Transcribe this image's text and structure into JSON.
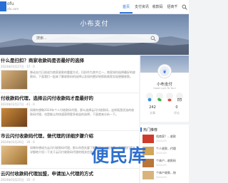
{
  "header": {
    "logo_text": "ofu",
    "logo_sub": "ofu.com",
    "nav": [
      "首页",
      "支付资讯",
      "收款码",
      "招商千"
    ],
    "active_index": 0
  },
  "banner": {
    "title": "小布支付",
    "search_placeholder": "搜索..."
  },
  "posts": [
    {
      "title": "什么是扫扣？商家收款码是否最好的选择",
      "meta": "2024年03月27日 · 37 · 0",
      "excerpt": "移动支付已经成为商家收款的重要方式，扫扣作为其中之一，商家如何选择最好的收款码，下面我们一起来了解收款码的选择以及如何更好地帮助商家实现便捷收款。"
    },
    {
      "title": "付收款码代理，选择云闪付收款码才是最好的",
      "meta": "2024年03月27日 · 41 · 0",
      "excerpt": "如果你想做2024年个人付收款码代理，那么选择云闪付收款码，这样既是优选的收款码代理，也是能让你快速获得更多收益的选择，下面就来分析一下。"
    },
    {
      "title": "市云闪付收款码代理，做代理的详细步骤介绍",
      "meta": "2024年03月26日 · 36 · 0",
      "excerpt": "如果你想成为云闪付收款码代理，那么你首先要了解代理的详细步骤，下面我们就来详细地介绍一下关于云闪付收款码代理的相关信息。"
    },
    {
      "title": "云闪付收款码代理加盟，申请加入代理的方式",
      "meta": "2024年03月25日 · 35 · 0",
      "excerpt": ""
    }
  ],
  "sidebar": {
    "profile_name": "小布支付",
    "profile_sub": "Good Luck To You!",
    "stats": [
      {
        "value": "242",
        "label": "文章"
      },
      {
        "value": "0",
        "label": "评论"
      }
    ],
    "hot_title": "热门推荐",
    "hot_items": [
      {
        "text": "找商家？...收款",
        "date": "2024-03"
      },
      {
        "text": "个人收款...代理",
        "date": "2024-03"
      },
      {
        "text": "个体户...收款码",
        "date": "2024-03"
      },
      {
        "text": "个体户收款...快",
        "date": "2024-03"
      }
    ]
  },
  "watermark": "便民库",
  "colors": {
    "accent": "#2a6fd6",
    "watermark": "#1e63c9"
  }
}
